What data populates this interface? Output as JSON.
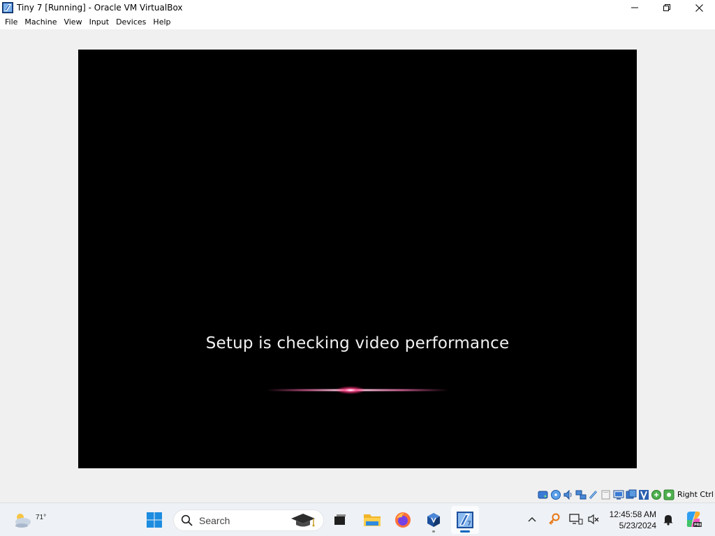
{
  "window": {
    "title": "Tiny 7 [Running] - Oracle VM VirtualBox"
  },
  "menu": [
    "File",
    "Machine",
    "View",
    "Input",
    "Devices",
    "Help"
  ],
  "vm": {
    "message": "Setup is checking video performance"
  },
  "statusbar": {
    "icons": [
      "hard-disk-icon",
      "optical-drive-icon",
      "audio-icon",
      "network-icon",
      "usb-icon",
      "shared-folders-icon",
      "display-icon",
      "recording-icon",
      "virtualization-icon",
      "mouse-integration-icon",
      "keyboard-icon"
    ],
    "host_key": "Right Ctrl"
  },
  "taskbar": {
    "weather_temp": "71°",
    "search_label": "Search",
    "apps": [
      "start-button",
      "task-view",
      "file-explorer",
      "firefox",
      "virtualbox-manager",
      "virtualbox-vm"
    ],
    "clock_time": "12:45:58 AM",
    "clock_date": "5/23/2024",
    "accent_color": "#0067c0"
  }
}
